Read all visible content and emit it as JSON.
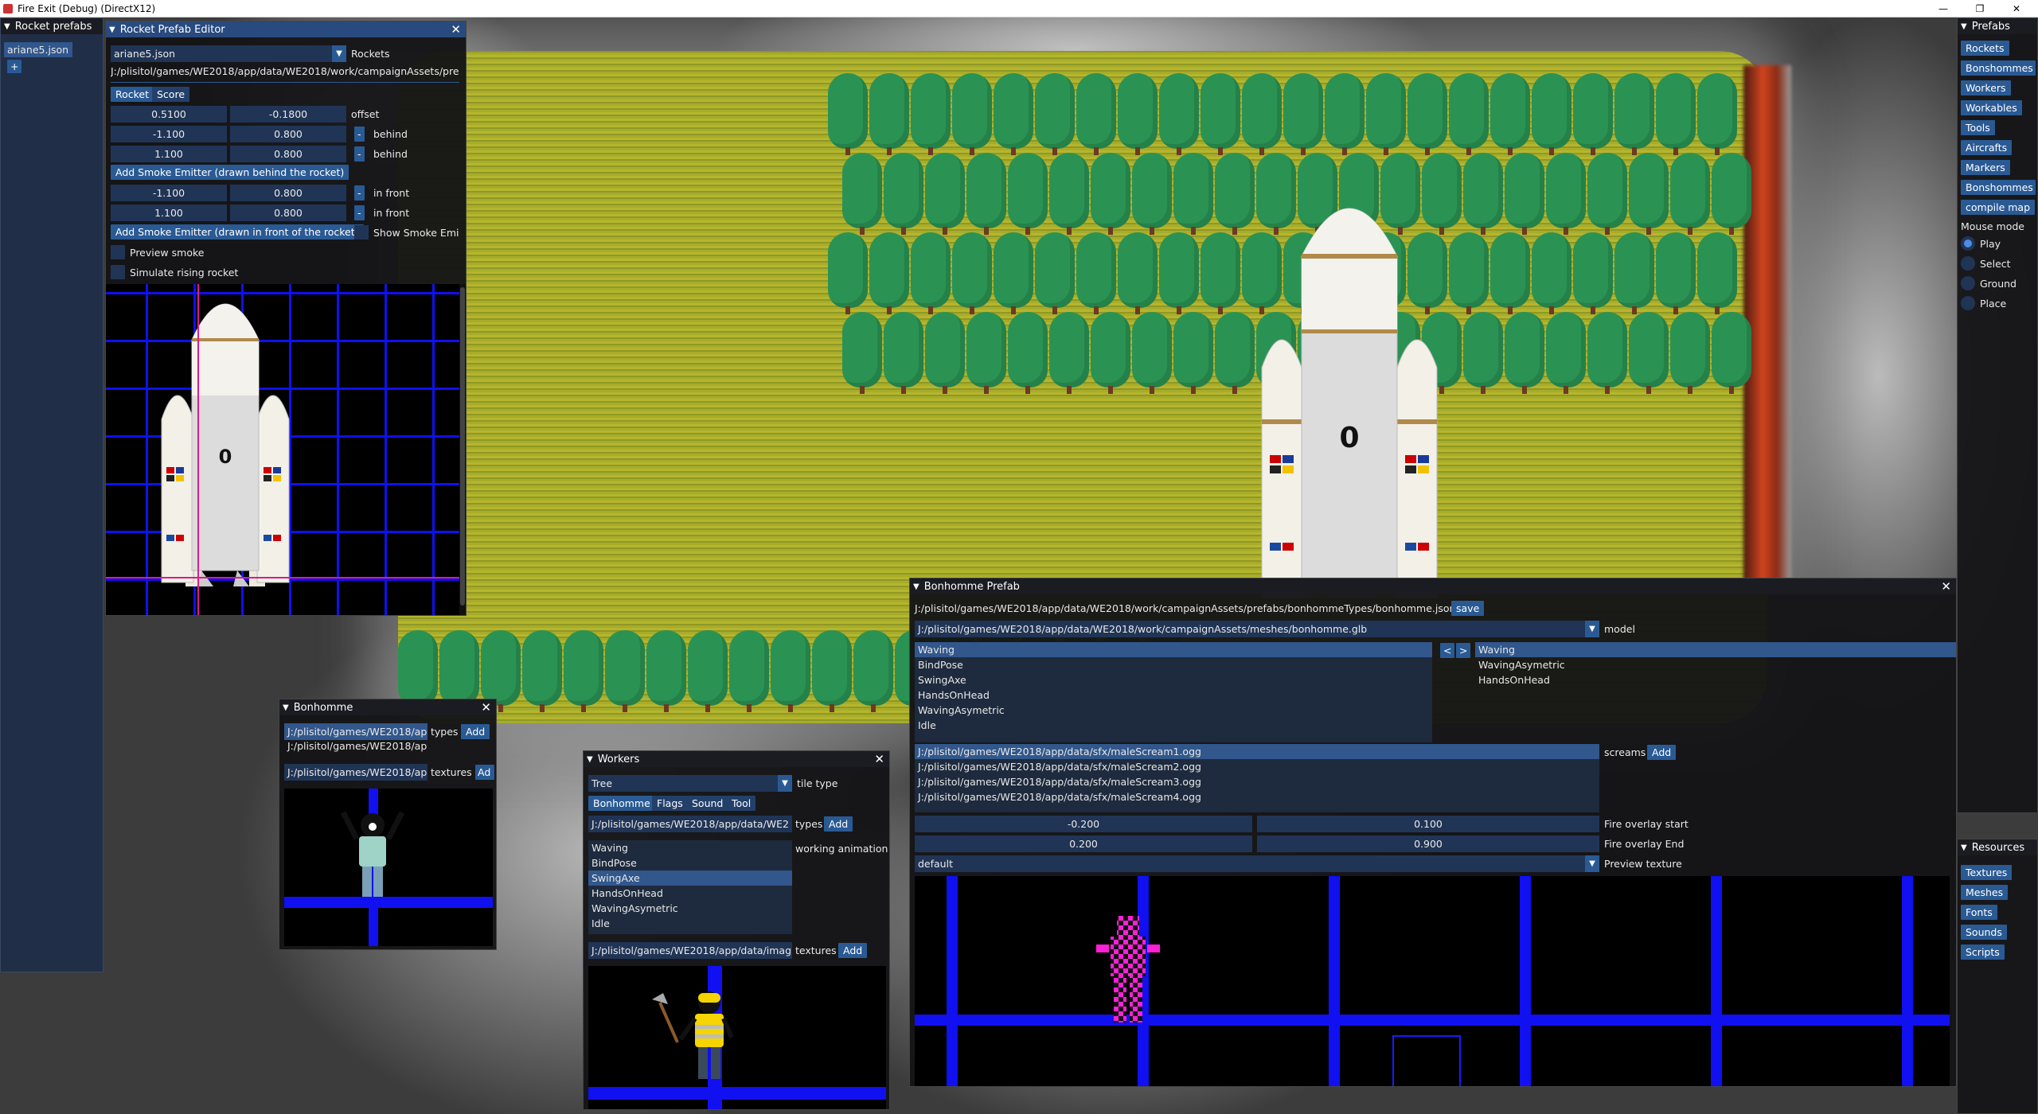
{
  "window": {
    "title": "Fire Exit (Debug) (DirectX12)"
  },
  "rocket_prefabs": {
    "title": "Rocket prefabs",
    "selected_file": "ariane5.json",
    "add_label": "+"
  },
  "rocket_editor": {
    "title": "Rocket Prefab Editor",
    "file": "ariane5.json",
    "category": "Rockets",
    "path": "J:/plisitol/games/WE2018/app/data/WE2018/work/campaignAssets/pre",
    "tabs": [
      "Rocket",
      "Score"
    ],
    "offset": {
      "x": "0.5100",
      "y": "-0.1800",
      "label": "offset"
    },
    "behind_rows": [
      {
        "x": "-1.100",
        "y": "0.800",
        "minus": "-",
        "label": "behind"
      },
      {
        "x": "1.100",
        "y": "0.800",
        "minus": "-",
        "label": "behind"
      }
    ],
    "add_behind_label": "Add Smoke Emitter (drawn behind the rocket)",
    "front_rows": [
      {
        "x": "-1.100",
        "y": "0.800",
        "minus": "-",
        "label": "in front"
      },
      {
        "x": "1.100",
        "y": "0.800",
        "minus": "-",
        "label": "in front"
      }
    ],
    "add_front_label": "Add Smoke Emitter (drawn in front of the rocket)",
    "show_smoke_label": "Show Smoke Emi",
    "preview_smoke_label": "Preview smoke",
    "simulate_label": "Simulate rising rocket",
    "rocket_number": "0"
  },
  "game": {
    "rocket_number": "0"
  },
  "bonhomme_small": {
    "title": "Bonhomme",
    "type_path1": "J:/plisitol/games/WE2018/ap",
    "type_path2": "J:/plisitol/games/WE2018/ap",
    "types_label": "types",
    "add_label": "Add",
    "texture_path": "J:/plisitol/games/WE2018/ap",
    "textures_label": "textures",
    "add_tex_label": "Ad"
  },
  "workers": {
    "title": "Workers",
    "tile_type_value": "Tree",
    "tile_type_label": "tile type",
    "tabs": [
      "Bonhomme",
      "Flags",
      "Sound",
      "Tool"
    ],
    "type_path": "J:/plisitol/games/WE2018/app/data/WE2",
    "types_label": "types",
    "add_label": "Add",
    "animations": [
      "Waving",
      "BindPose",
      "SwingAxe",
      "HandsOnHead",
      "WavingAsymetric",
      "Idle"
    ],
    "selected_animation": "SwingAxe",
    "animation_label": "working animation",
    "texture_path": "J:/plisitol/games/WE2018/app/data/imag",
    "textures_label": "textures",
    "add_tex_label": "Add"
  },
  "bonhomme_prefab": {
    "title": "Bonhomme Prefab",
    "path": "J:/plisitol/games/WE2018/app/data/WE2018/work/campaignAssets/prefabs/bonhommeTypes/bonhomme.json",
    "save_label": "save",
    "model_path": "J:/plisitol/games/WE2018/app/data/WE2018/work/campaignAssets/meshes/bonhomme.glb",
    "model_label": "model",
    "animations": [
      "Waving",
      "BindPose",
      "SwingAxe",
      "HandsOnHead",
      "WavingAsymetric",
      "Idle"
    ],
    "left_arrow": "<",
    "right_arrow": ">",
    "chosen": [
      "Waving",
      "WavingAsymetric",
      "HandsOnHead"
    ],
    "screams": [
      "J:/plisitol/games/WE2018/app/data/sfx/maleScream1.ogg",
      "J:/plisitol/games/WE2018/app/data/sfx/maleScream2.ogg",
      "J:/plisitol/games/WE2018/app/data/sfx/maleScream3.ogg",
      "J:/plisitol/games/WE2018/app/data/sfx/maleScream4.ogg"
    ],
    "screams_label": "screams",
    "add_label": "Add",
    "fire_start": {
      "a": "-0.200",
      "b": "0.100",
      "label": "Fire overlay start"
    },
    "fire_end": {
      "a": "0.200",
      "b": "0.900",
      "label": "Fire overlay End"
    },
    "preview_texture": "default",
    "preview_texture_label": "Preview texture"
  },
  "prefabs_panel": {
    "title": "Prefabs",
    "items": [
      "Rockets",
      "Bonshommes",
      "Workers",
      "Workables",
      "Tools",
      "Aircrafts",
      "Markers",
      "Bonshommes",
      "compile map"
    ],
    "mouse_mode_label": "Mouse mode",
    "modes": [
      "Play",
      "Select",
      "Ground",
      "Place"
    ],
    "selected_mode": "Play"
  },
  "resources_panel": {
    "title": "Resources",
    "items": [
      "Textures",
      "Meshes",
      "Fonts",
      "Sounds",
      "Scripts"
    ]
  }
}
